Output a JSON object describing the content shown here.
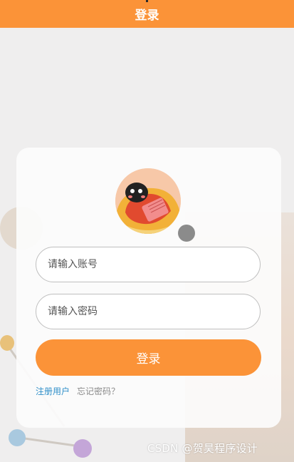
{
  "header": {
    "title": "登录"
  },
  "avatar": {
    "icon": "cartoon-reading-character"
  },
  "form": {
    "account_placeholder": "请输入账号",
    "password_placeholder": "请输入密码",
    "login_label": "登录"
  },
  "links": {
    "register_label": "注册用户",
    "forgot_label": "忘记密码？"
  },
  "watermark": {
    "text": "CSDN @贺昊程序设计"
  },
  "colors": {
    "accent": "#fb9338",
    "link": "#2f8fc9",
    "background": "#efeeee"
  }
}
